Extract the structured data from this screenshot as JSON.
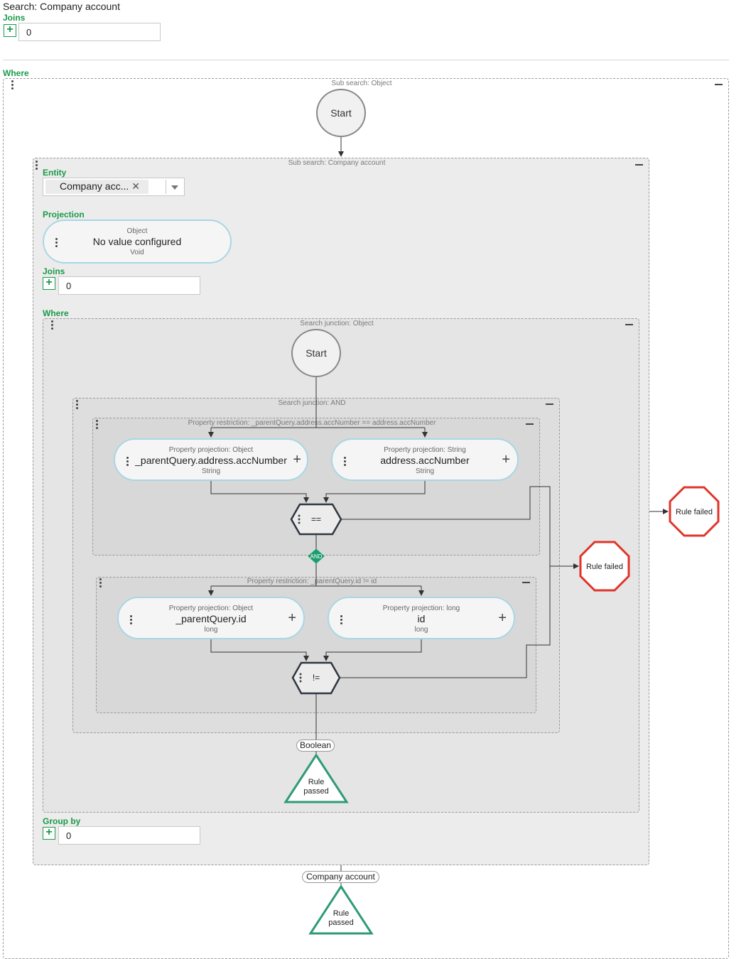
{
  "title": "Search: Company account",
  "top": {
    "joins_label": "Joins",
    "joins_value": "0",
    "where_label": "Where"
  },
  "outer_sub": {
    "title": "Sub search: Object",
    "start": "Start",
    "result_tag": "Company account",
    "rule_passed": "Rule passed",
    "rule_failed": "Rule failed"
  },
  "inner_sub": {
    "title": "Sub search: Company account",
    "entity_label": "Entity",
    "entity_value": "Company acc...",
    "projection_label": "Projection",
    "projection": {
      "type": "Object",
      "value": "No value configured",
      "result": "Void"
    },
    "joins_label": "Joins",
    "joins_value": "0",
    "where_label": "Where",
    "group_by_label": "Group by",
    "group_by_value": "0",
    "rule_failed": "Rule failed"
  },
  "junction_obj": {
    "title": "Search junction: Object",
    "start": "Start",
    "result_tag": "Boolean",
    "rule_passed": "Rule passed"
  },
  "junction_and": {
    "title": "Search junction: AND",
    "and_label": "AND"
  },
  "restriction_eq": {
    "title": "Property restriction: _parentQuery.address.accNumber == address.accNumber",
    "left": {
      "type": "Property projection: Object",
      "value": "_parentQuery.address.accNumber",
      "result": "String"
    },
    "right": {
      "type": "Property projection: String",
      "value": "address.accNumber",
      "result": "String"
    },
    "operator": "=="
  },
  "restriction_ne": {
    "title": "Property restriction: _parentQuery.id != id",
    "left": {
      "type": "Property projection: Object",
      "value": "_parentQuery.id",
      "result": "long"
    },
    "right": {
      "type": "Property projection: long",
      "value": "id",
      "result": "long"
    },
    "operator": "!="
  },
  "colors": {
    "green_label": "#1a9a4a",
    "pill_border": "#a9d6e5",
    "rule_failed": "#e0342a",
    "rule_passed": "#2e9a78",
    "operator_border": "#2f3640"
  }
}
